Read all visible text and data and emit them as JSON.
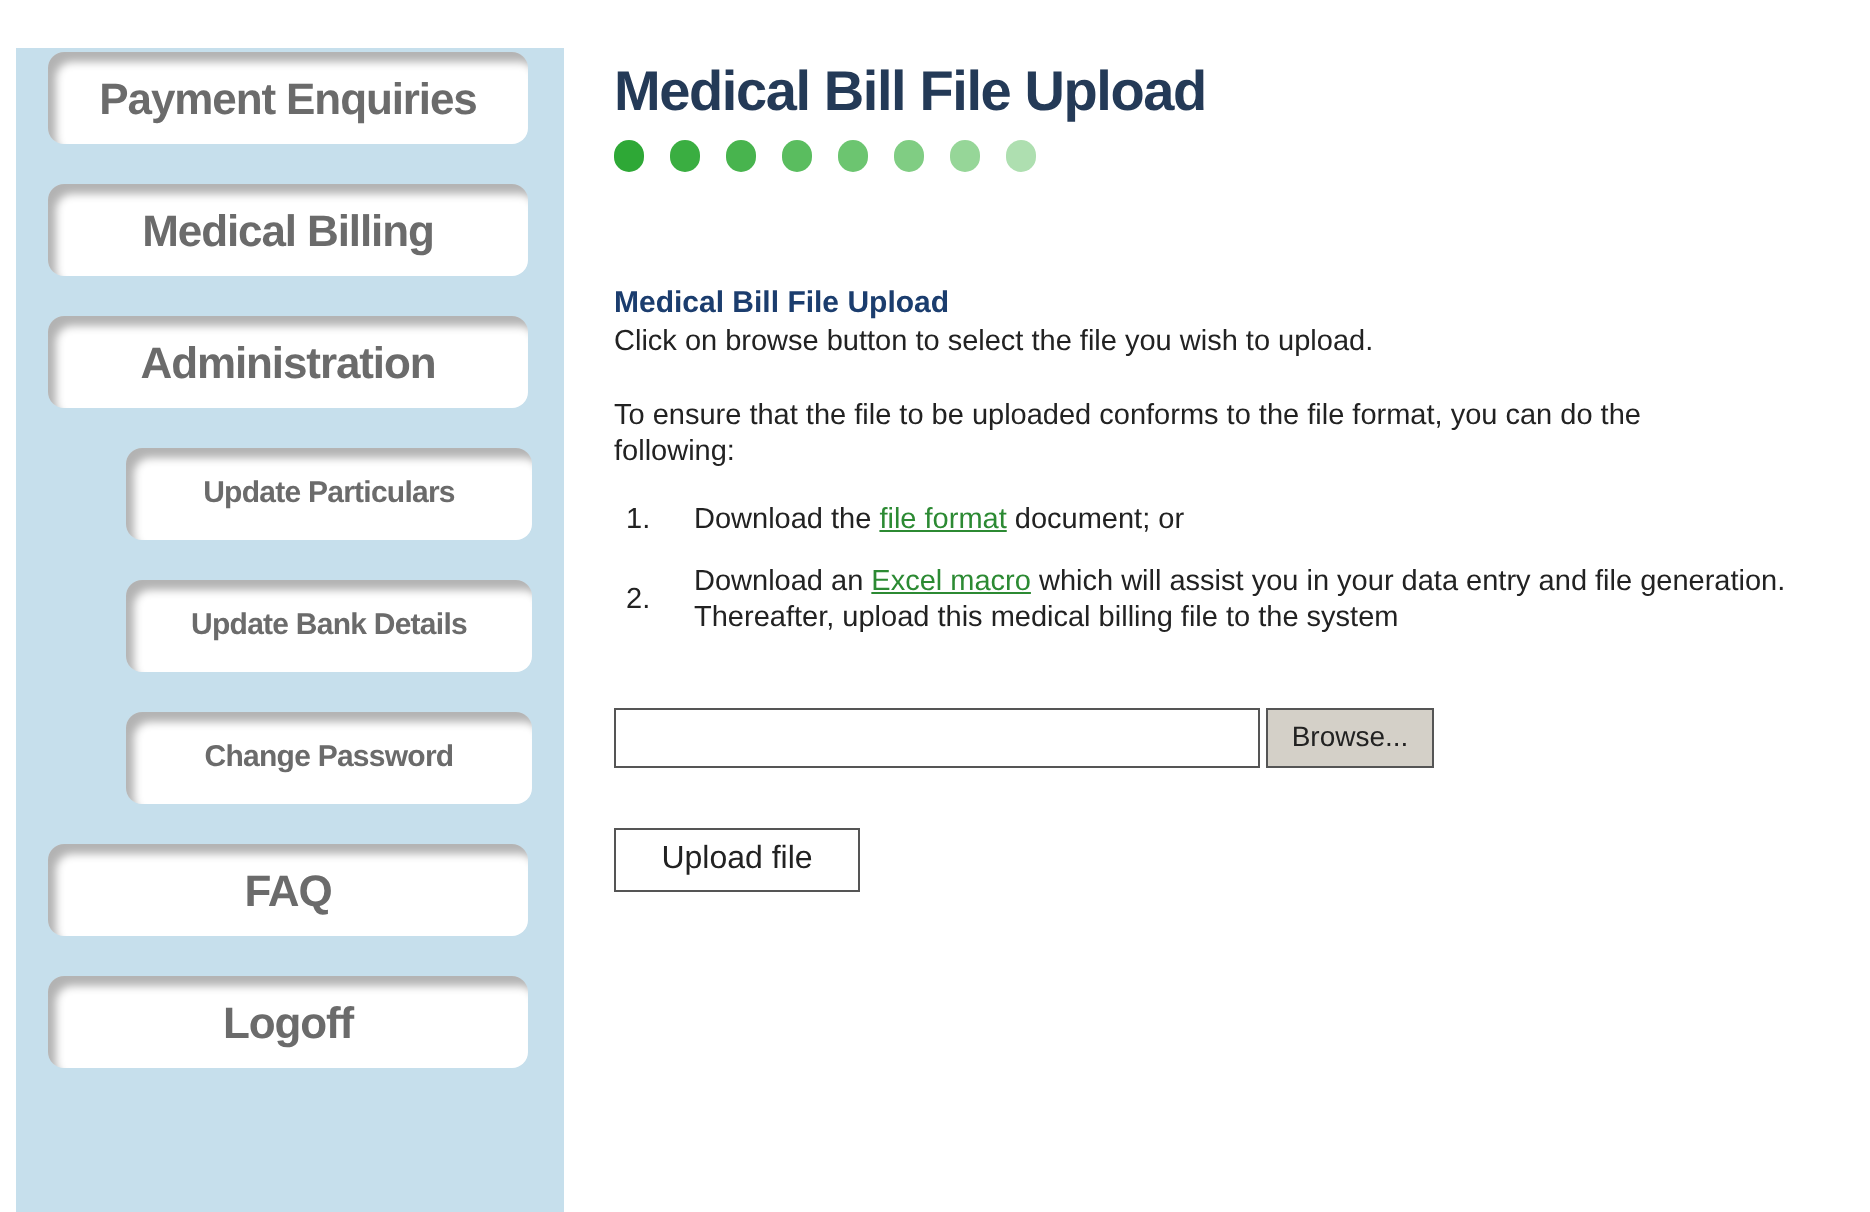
{
  "sidebar": {
    "items": [
      {
        "label": "Payment Enquiries",
        "kind": "main"
      },
      {
        "label": "Medical Billing",
        "kind": "main"
      },
      {
        "label": "Administration",
        "kind": "main"
      },
      {
        "label": "Update Particulars",
        "kind": "sub"
      },
      {
        "label": "Update Bank Details",
        "kind": "sub"
      },
      {
        "label": "Change Password",
        "kind": "sub"
      },
      {
        "label": "FAQ",
        "kind": "main"
      },
      {
        "label": "Logoff",
        "kind": "main"
      }
    ]
  },
  "page": {
    "title": "Medical Bill File Upload",
    "progress_dots": [
      {
        "color": "#2ea836"
      },
      {
        "color": "#3aae41"
      },
      {
        "color": "#48b44e"
      },
      {
        "color": "#5abd5f"
      },
      {
        "color": "#6cc570"
      },
      {
        "color": "#80cd83"
      },
      {
        "color": "#96d698"
      },
      {
        "color": "#aedfb0"
      }
    ],
    "section_title": "Medical Bill File Upload",
    "instruction": "Click on browse button to select the file you wish to upload.",
    "intro": "To ensure that the file to be uploaded conforms to the file format, you can do the following:",
    "steps": [
      {
        "number": "1.",
        "parts": [
          {
            "kind": "text",
            "text": "Download the "
          },
          {
            "kind": "link",
            "text": "file format"
          },
          {
            "kind": "text",
            "text": " document; or"
          }
        ]
      },
      {
        "number": "2.",
        "parts": [
          {
            "kind": "text",
            "text": "Download an "
          },
          {
            "kind": "link",
            "text": "Excel macro"
          },
          {
            "kind": "text",
            "text": " which will assist you in your data entry and file generation. Thereafter, upload this medical billing file to the system"
          }
        ]
      }
    ],
    "browse_button": "Browse...",
    "upload_button": "Upload file"
  }
}
